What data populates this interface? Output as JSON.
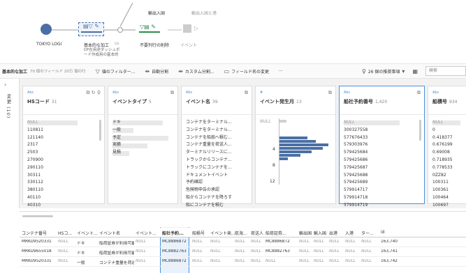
{
  "flow": {
    "nodes": [
      {
        "label": "TOKYO LOGI"
      },
      {
        "label": "基本的な加工",
        "sub": "DF在用途ダッシュボ\nード作成用の基本的"
      },
      {
        "label": "不要列行の削除"
      },
      {
        "label": "イベント"
      },
      {
        "label": "輸出入国"
      },
      {
        "label": "輸出入国と港"
      }
    ]
  },
  "toolbar": {
    "title": "基本的な加工",
    "meta": "70 個のフィールド 20万 個の行",
    "filter": "値のフィルター...",
    "auto_split": "自動分割",
    "custom_split": "カスタム分割...",
    "rename": "フィールド名の変更",
    "more": "···",
    "recommend": "26 個の推奨事項",
    "search_placeholder": "検索"
  },
  "leftrail": {
    "label": "変更 (10)"
  },
  "cards": [
    {
      "type": "Abc",
      "name": "HSコード",
      "count": "31",
      "values": [
        "NULL",
        "110811",
        "121140",
        "2317",
        "2503",
        "270900",
        "290110",
        "30311",
        "330112",
        "380110",
        "40110",
        "40310"
      ]
    },
    {
      "type": "Abc",
      "name": "イベントタイプ",
      "count": "5",
      "values": [
        "ドキ",
        "一般",
        "予定",
        "実績",
        "見積"
      ]
    },
    {
      "type": "Abc",
      "name": "イベント名",
      "count": "39",
      "values": [
        "コンテナをターミナル...",
        "コンテナをターミナル...",
        "コンテナを船舶へ積む...",
        "コンテナ重量を荷送人...",
        "ターミナルリリースに...",
        "トラックからコンテナ...",
        "トラックにコンテナを...",
        "ドキュメントイベント",
        "予約確認",
        "危険物申告の承認",
        "船からコンテナを降ろす",
        "船にコンテナを積む"
      ]
    },
    {
      "type": "#",
      "name": "イベント発生月",
      "count": "13",
      "values": [
        "NULL",
        "4",
        "8",
        "12"
      ]
    },
    {
      "type": "Abc",
      "name": "船社予約番号",
      "count": "1,420",
      "values": [
        "NULL",
        "300327558",
        "577676433",
        "579303976",
        "579425684",
        "579425686",
        "579425687",
        "579425688",
        "579425689",
        "579914717",
        "579914718",
        "579914719"
      ]
    },
    {
      "type": "Abc",
      "name": "船積号",
      "count": "934",
      "values": [
        "NULL",
        "0",
        "0.418377",
        "0.676199",
        "0.69008",
        "0.718935",
        "0.778533",
        "0ZZ82",
        "100311",
        "100361",
        "100464",
        "100697"
      ]
    }
  ],
  "grid": {
    "headers": [
      "コンテナ番号",
      "HSコ...",
      "イベント...",
      "イベント名",
      "イベント...",
      "船社予約...",
      "船積号",
      "イベント発...",
      "航海...",
      "荷送人",
      "船荷証券...",
      "輸出国",
      "輸入国",
      "出港",
      "入港",
      "ター...",
      "id"
    ],
    "rows": [
      [
        "MRKU9520331",
        "NULL",
        "ドキ",
        "船荷証券が利用可能",
        "NULL",
        "MC8886872",
        "NULL",
        "NULL",
        "NULL",
        "NULL",
        "MC8886872",
        "NULL",
        "NULL",
        "NULL",
        "NULL",
        "NULL",
        "163,740"
      ],
      [
        "MRKU9655018",
        "NULL",
        "ドキ",
        "船荷証券が利用可能",
        "NULL",
        "MC8882763",
        "NULL",
        "NULL",
        "NULL",
        "NULL",
        "MC8882763",
        "NULL",
        "NULL",
        "NULL",
        "NULL",
        "NULL",
        "163,741"
      ],
      [
        "MRKU9520331",
        "NULL",
        "一般",
        "コンテナ重量を荷送人",
        "NULL",
        "MC8886872",
        "NULL",
        "NULL",
        "NULL",
        "NULL",
        "NULL",
        "NULL",
        "NULL",
        "NULL",
        "NULL",
        "NULL",
        "163,742"
      ]
    ]
  }
}
